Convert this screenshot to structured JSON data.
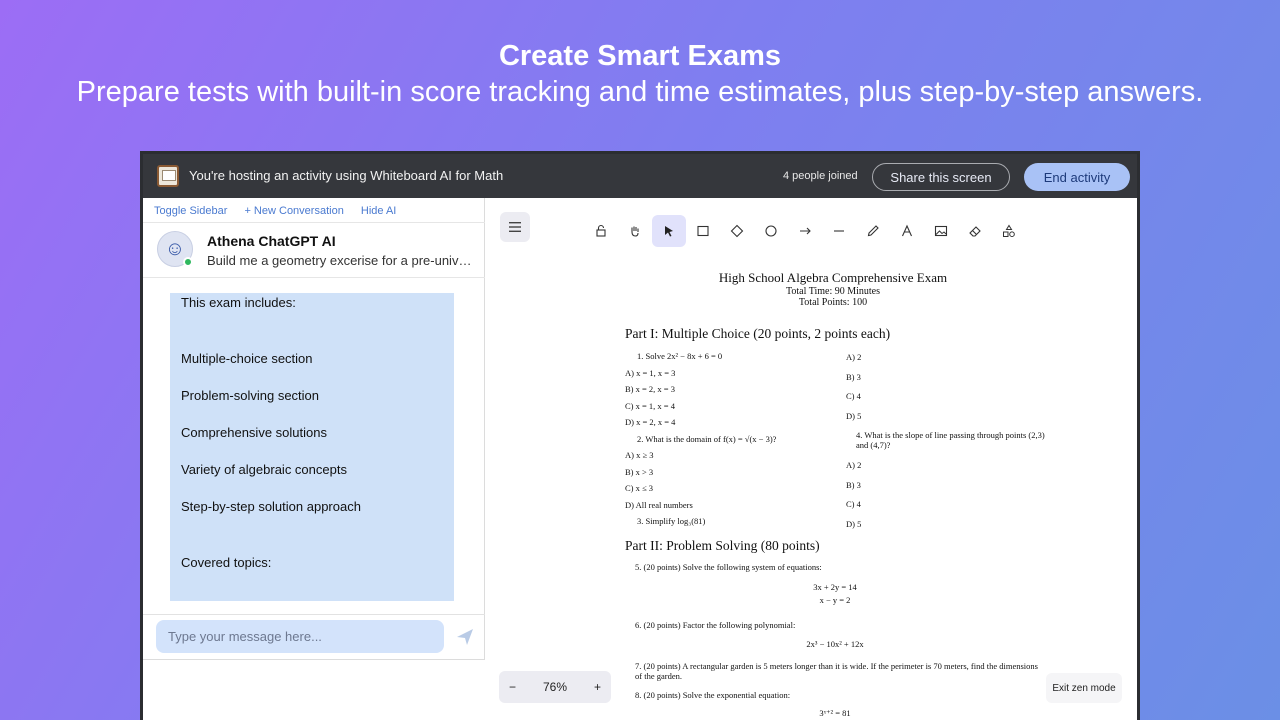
{
  "hero": {
    "title": "Create Smart Exams",
    "subtitle": "Prepare tests with built-in score tracking and time estimates, plus step-by-step answers."
  },
  "topbar": {
    "hosting_text": "You're hosting an activity using Whiteboard AI for Math",
    "people_joined": "4 people joined",
    "share_label": "Share this screen",
    "end_label": "End activity"
  },
  "sidebar": {
    "links": [
      "Toggle Sidebar",
      "+ New Conversation",
      "Hide AI"
    ],
    "bot_name": "Athena ChatGPT AI",
    "bot_preview": "Build me a geometry excerise for a pre-university student",
    "message_lines": [
      "This exam includes:",
      "Multiple-choice section",
      "Problem-solving section",
      "Comprehensive solutions",
      "Variety of algebraic concepts",
      "Step-by-step solution approach",
      "Covered topics:"
    ],
    "input_placeholder": "Type your message here..."
  },
  "toolbar": {
    "tools": [
      "lock-icon",
      "hand-icon",
      "pointer-icon",
      "rectangle-icon",
      "diamond-icon",
      "ellipse-icon",
      "arrow-icon",
      "line-icon",
      "pencil-icon",
      "text-icon",
      "image-icon",
      "eraser-icon",
      "shapes-icon"
    ],
    "active_tool": "pointer-icon"
  },
  "document": {
    "title": "High School Algebra Comprehensive Exam",
    "time": "Total Time: 90 Minutes",
    "points": "Total Points: 100",
    "part1_heading": "Part I: Multiple Choice (20 points, 2 points each)",
    "q1": "1. Solve 2x² − 8x + 6 = 0",
    "q1_options": [
      "A) x = 1, x = 3",
      "B) x = 2, x = 3",
      "C) x = 1, x = 4",
      "D) x = 2, x = 4"
    ],
    "q2": "2. What is the domain of f(x) = √(x − 3)?",
    "q2_options": [
      "A) x ≥ 3",
      "B) x > 3",
      "C) x ≤ 3",
      "D) All real numbers"
    ],
    "q3": "3. Simplify log₃(81)",
    "right_options_a": [
      "A) 2",
      "B) 3",
      "C) 4",
      "D) 5"
    ],
    "q4": "4. What is the slope of line passing through points (2,3) and (4,7)?",
    "right_options_b": [
      "A) 2",
      "B) 3",
      "C) 4",
      "D) 5"
    ],
    "part2_heading": "Part II: Problem Solving (80 points)",
    "q5": "5. (20 points) Solve the following system of equations:",
    "q5_eq1": "3x + 2y = 14",
    "q5_eq2": "x − y = 2",
    "q6": "6. (20 points) Factor the following polynomial:",
    "q6_eq": "2x³ − 10x² + 12x",
    "q7": "7. (20 points) A rectangular garden is 5 meters longer than it is wide. If the perimeter is 70 meters, find the dimensions of the garden.",
    "q8": "8. (20 points) Solve the exponential equation:",
    "q8_eq": "3ˣ⁺² = 81"
  },
  "zoom": {
    "minus": "−",
    "level": "76%",
    "plus": "+"
  },
  "exit_zen_label": "Exit zen mode",
  "colors": {
    "accent": "#a9c2f6",
    "topbar": "#35373c",
    "bubble": "#cfe1f8",
    "active_tool": "#e1e2fb"
  }
}
